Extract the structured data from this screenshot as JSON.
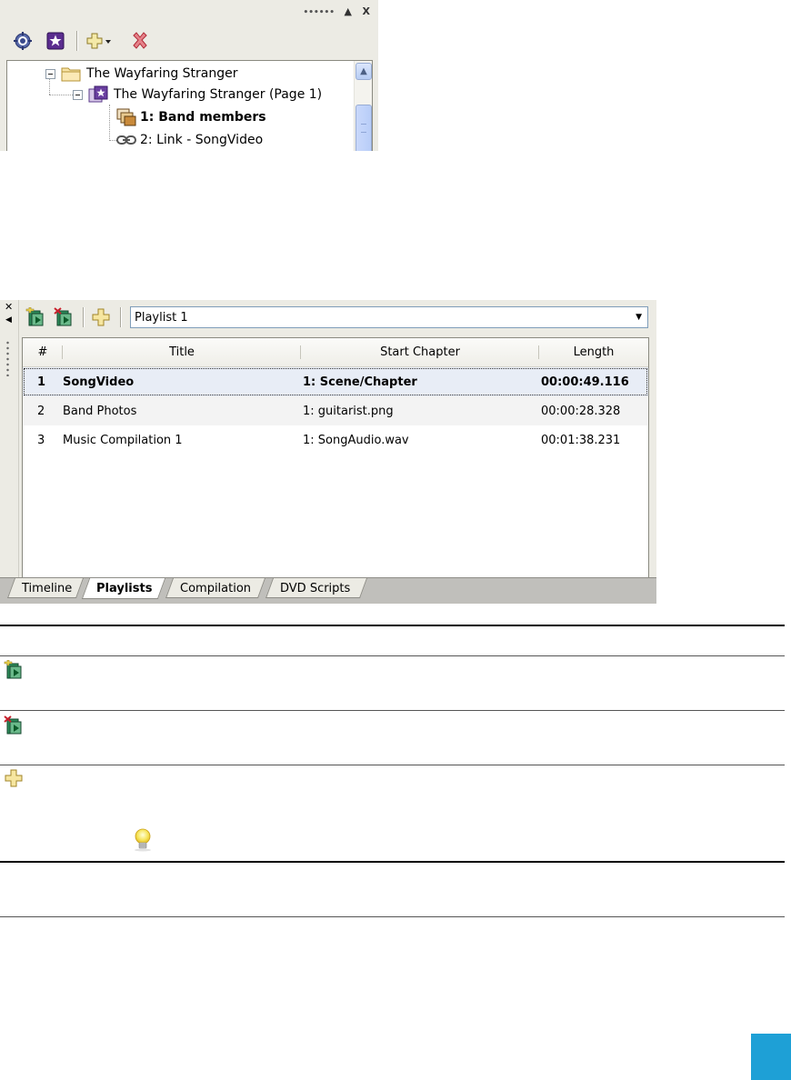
{
  "tree_panel": {
    "titlebar": {
      "grip": "••••••",
      "collapse": "▲",
      "close": "X"
    },
    "toolbar": [
      {
        "name": "target-icon"
      },
      {
        "name": "star-page-icon"
      },
      {
        "name": "add-cross-dropdown-icon"
      },
      {
        "name": "delete-x-icon"
      }
    ],
    "items": [
      {
        "label": "The Wayfaring Stranger",
        "icon": "folder-icon",
        "level": 0
      },
      {
        "label": "The Wayfaring Stranger (Page 1)",
        "icon": "menu-page-icon",
        "level": 1
      },
      {
        "label": "1: Band members",
        "icon": "slideshow-icon",
        "level": 2,
        "bold": true
      },
      {
        "label": "2: Link - SongVideo",
        "icon": "link-icon",
        "level": 2
      }
    ]
  },
  "playlist_window": {
    "rail": {
      "close": "✕",
      "arrow": "◀"
    },
    "toolbar": [
      {
        "name": "add-playlist-icon"
      },
      {
        "name": "remove-playlist-icon"
      },
      {
        "name": "add-item-icon"
      }
    ],
    "selected_playlist": "Playlist 1",
    "columns": [
      "#",
      "Title",
      "Start Chapter",
      "Length"
    ],
    "rows": [
      {
        "num": "1",
        "title": "SongVideo",
        "chapter": "1: Scene/Chapter",
        "length": "00:00:49.116",
        "selected": true
      },
      {
        "num": "2",
        "title": "Band Photos",
        "chapter": "1: guitarist.png",
        "length": "00:00:28.328"
      },
      {
        "num": "3",
        "title": "Music Compilation 1",
        "chapter": "1: SongAudio.wav",
        "length": "00:01:38.231"
      }
    ],
    "tabs": [
      {
        "label": "Timeline",
        "active": false
      },
      {
        "label": "Playlists",
        "active": true
      },
      {
        "label": "Compilation",
        "active": false
      },
      {
        "label": "DVD Scripts",
        "active": false
      }
    ]
  },
  "reference_table": {
    "rows": [
      {
        "icon": "add-playlist-icon"
      },
      {
        "icon": "remove-playlist-icon"
      },
      {
        "icon": "add-item-icon"
      }
    ],
    "tip_icon": "lightbulb-icon"
  },
  "colors": {
    "panel_bg": "#ecebe4",
    "selected_row": "#e8edf6",
    "page_marker": "#1ea0d6"
  }
}
